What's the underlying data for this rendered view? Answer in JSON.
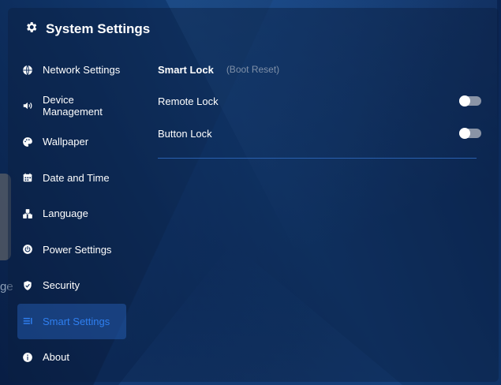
{
  "window": {
    "title": "System Settings"
  },
  "sidebar": {
    "items": [
      {
        "label": "Network Settings",
        "icon": "globe-icon"
      },
      {
        "label": "Device Management",
        "icon": "speaker-icon"
      },
      {
        "label": "Wallpaper",
        "icon": "palette-icon"
      },
      {
        "label": "Date and Time",
        "icon": "calendar-icon"
      },
      {
        "label": "Language",
        "icon": "language-icon"
      },
      {
        "label": "Power Settings",
        "icon": "power-icon"
      },
      {
        "label": "Security",
        "icon": "shield-icon"
      },
      {
        "label": "Smart Settings",
        "icon": "list-icon",
        "active": true
      },
      {
        "label": "About",
        "icon": "info-icon"
      }
    ]
  },
  "background": {
    "partial_text": "ge"
  },
  "main": {
    "tabs": [
      {
        "label": "Smart Lock",
        "active": true
      },
      {
        "label": "(Boot Reset)",
        "active": false
      }
    ],
    "settings": [
      {
        "label": "Remote Lock",
        "enabled": false
      },
      {
        "label": "Button Lock",
        "enabled": false
      }
    ]
  },
  "colors": {
    "accent": "#2f7ff0",
    "divider": "#2a61b0",
    "toggle_off": "#8a94a6"
  }
}
